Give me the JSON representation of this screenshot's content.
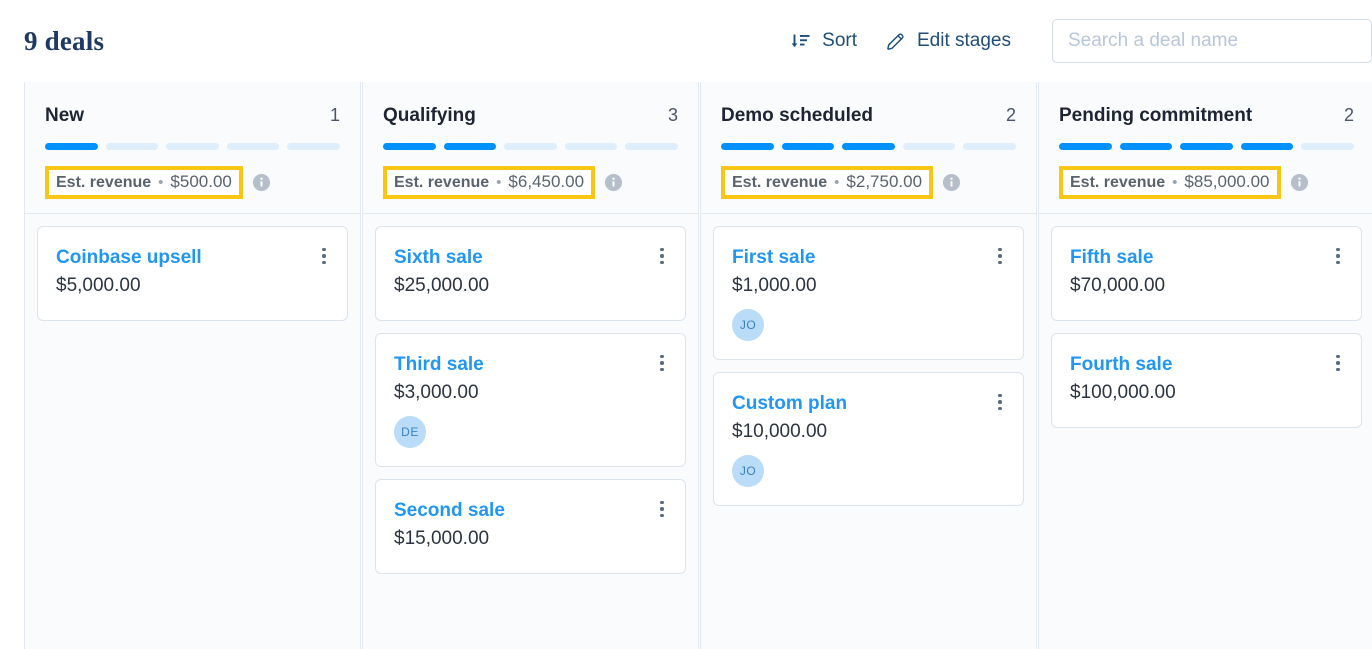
{
  "header": {
    "title": "9 deals",
    "sort_label": "Sort",
    "edit_stages_label": "Edit stages",
    "search_placeholder": "Search a deal name",
    "search_value": ""
  },
  "theme": {
    "accent_blue": "#0091ff",
    "link_blue": "#2196f3",
    "highlight_yellow": "#f9c713",
    "title_navy": "#1f3864",
    "muted_gray": "#59636e",
    "avatar_bg": "#badcf8"
  },
  "board": {
    "total_stages": 5,
    "revenue_label": "Est. revenue",
    "separator": "•",
    "columns": [
      {
        "name": "New",
        "count": "1",
        "filled_segments": 1,
        "est_revenue": "$500.00",
        "cards": [
          {
            "name": "Coinbase upsell",
            "amount": "$5,000.00",
            "avatar": ""
          }
        ]
      },
      {
        "name": "Qualifying",
        "count": "3",
        "filled_segments": 2,
        "est_revenue": "$6,450.00",
        "cards": [
          {
            "name": "Sixth sale",
            "amount": "$25,000.00",
            "avatar": ""
          },
          {
            "name": "Third sale",
            "amount": "$3,000.00",
            "avatar": "DE"
          },
          {
            "name": "Second sale",
            "amount": "$15,000.00",
            "avatar": ""
          }
        ]
      },
      {
        "name": "Demo scheduled",
        "count": "2",
        "filled_segments": 3,
        "est_revenue": "$2,750.00",
        "cards": [
          {
            "name": "First sale",
            "amount": "$1,000.00",
            "avatar": "JO"
          },
          {
            "name": "Custom plan",
            "amount": "$10,000.00",
            "avatar": "JO"
          }
        ]
      },
      {
        "name": "Pending commitment",
        "count": "2",
        "filled_segments": 4,
        "est_revenue": "$85,000.00",
        "cards": [
          {
            "name": "Fifth sale",
            "amount": "$70,000.00",
            "avatar": ""
          },
          {
            "name": "Fourth sale",
            "amount": "$100,000.00",
            "avatar": ""
          }
        ]
      }
    ]
  },
  "icons": {
    "sort": "sort-descending-icon",
    "edit": "pencil-icon",
    "info": "info-circle-icon",
    "kebab": "more-vertical-icon"
  }
}
